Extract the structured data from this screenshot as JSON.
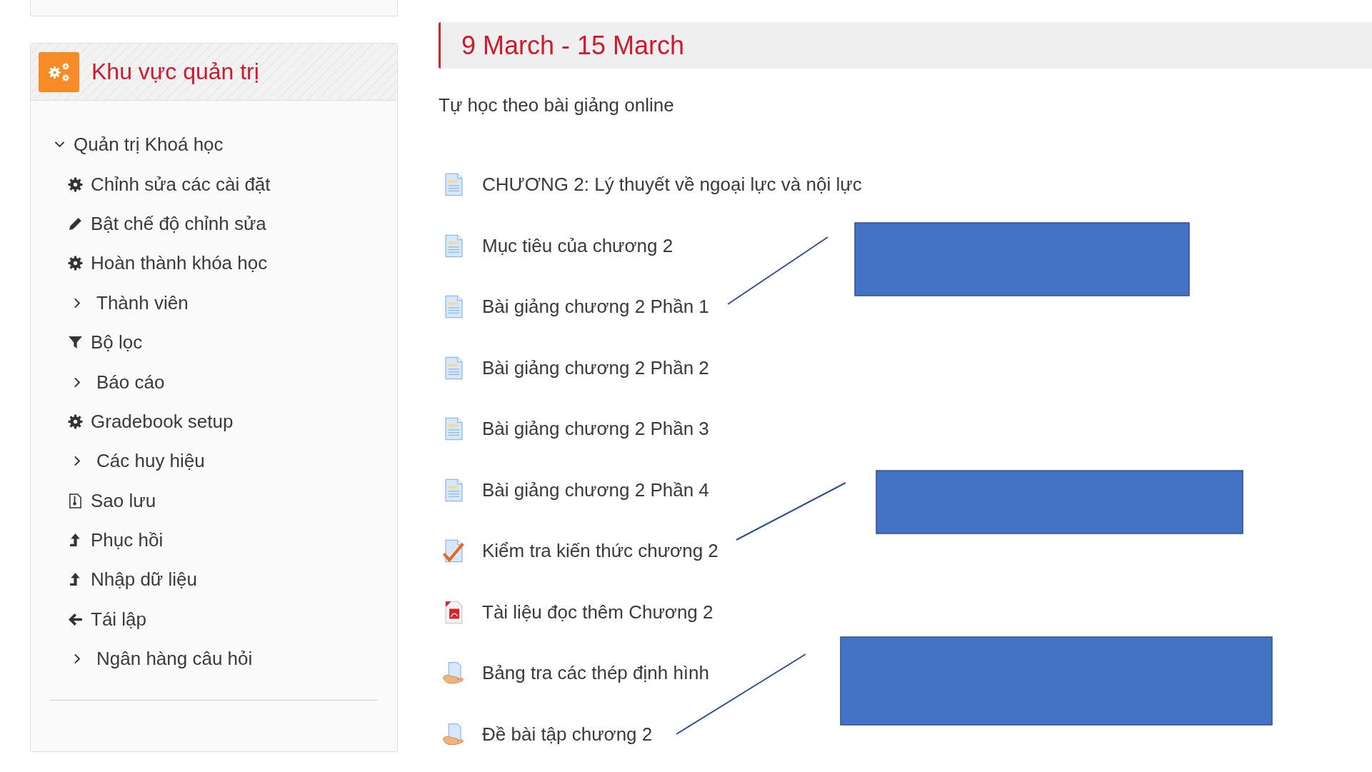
{
  "sidebar": {
    "title": "Khu vực quản trị",
    "root": {
      "label": "Quản trị Khoá học",
      "expanded": true,
      "children": [
        {
          "kind": "settings",
          "label": "Chỉnh sửa các cài đặt"
        },
        {
          "kind": "edit",
          "label": "Bật chế độ chỉnh sửa"
        },
        {
          "kind": "settings",
          "label": "Hoàn thành khóa học"
        },
        {
          "kind": "group",
          "label": "Thành viên",
          "expanded": false
        },
        {
          "kind": "filter",
          "label": "Bộ lọc"
        },
        {
          "kind": "group",
          "label": "Báo cáo",
          "expanded": false
        },
        {
          "kind": "settings",
          "label": "Gradebook setup"
        },
        {
          "kind": "group",
          "label": "Các huy hiệu",
          "expanded": false
        },
        {
          "kind": "backup",
          "label": "Sao lưu"
        },
        {
          "kind": "upload",
          "label": "Phục hồi"
        },
        {
          "kind": "upload",
          "label": "Nhập dữ liệu"
        },
        {
          "kind": "reset",
          "label": "Tái lập"
        },
        {
          "kind": "group",
          "label": "Ngân hàng câu hỏi",
          "expanded": false
        }
      ]
    }
  },
  "section": {
    "title": "9 March - 15 March",
    "summary": "Tự học theo bài giảng online",
    "activities": [
      {
        "kind": "page",
        "label": "CHƯƠNG 2: Lý thuyết về ngoại lực và nội lực"
      },
      {
        "kind": "page",
        "label": "Mục tiêu của chương 2"
      },
      {
        "kind": "page",
        "label": "Bài giảng chương 2 Phần 1"
      },
      {
        "kind": "page",
        "label": "Bài giảng chương 2 Phần 2"
      },
      {
        "kind": "page",
        "label": "Bài giảng chương 2 Phần 3"
      },
      {
        "kind": "page",
        "label": "Bài giảng chương 2 Phần 4"
      },
      {
        "kind": "quiz",
        "label": "Kiểm tra kiến thức chương 2"
      },
      {
        "kind": "pdf",
        "label": "Tài liệu đọc thêm Chương 2"
      },
      {
        "kind": "assignment",
        "label": "Bảng tra các thép định hình"
      },
      {
        "kind": "assignment",
        "label": "Đề bài tập chương 2"
      }
    ]
  },
  "callouts": [
    {
      "kind": "box"
    },
    {
      "kind": "box"
    },
    {
      "kind": "box"
    }
  ]
}
